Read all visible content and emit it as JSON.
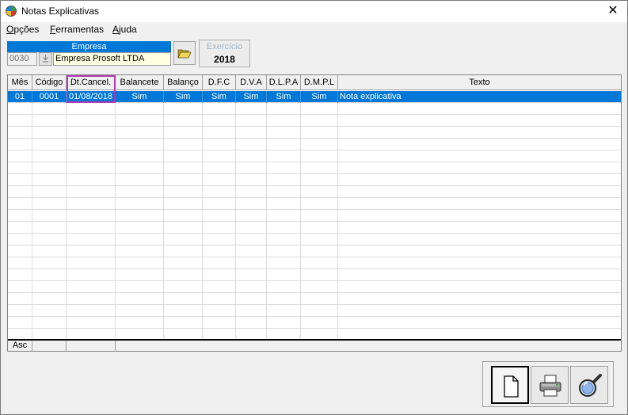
{
  "window": {
    "title": "Notas Explicativas",
    "close_glyph": "✕"
  },
  "menu": [
    {
      "underline": "O",
      "rest": "pções"
    },
    {
      "underline": "F",
      "rest": "erramentas"
    },
    {
      "underline": "A",
      "rest": "juda"
    }
  ],
  "empresa": {
    "header": "Empresa",
    "code": "0030",
    "name": "Empresa Prosoft LTDA"
  },
  "exercicio": {
    "label": "Exercício",
    "value": "2018"
  },
  "grid": {
    "columns": [
      "Mês",
      "Código",
      "Dt.Cancel.",
      "Balancete",
      "Balanço",
      "D.F.C",
      "D.V.A",
      "D.L.P.A",
      "D.M.P.L",
      "Texto"
    ],
    "rows": [
      [
        "01",
        "0001",
        "01/08/2018",
        "Sim",
        "Sim",
        "Sim",
        "Sim",
        "Sim",
        "Sim",
        "Nota explicativa"
      ]
    ],
    "footer": "Asc"
  },
  "toolbar": {
    "buttons": [
      {
        "name": "new-document-button",
        "icon": "document-icon"
      },
      {
        "name": "print-button",
        "icon": "printer-icon"
      },
      {
        "name": "search-button",
        "icon": "magnifier-icon"
      }
    ]
  },
  "colors": {
    "selection": "#0078d7",
    "highlight_box": "#b03ab5",
    "empresa_header": "#0078d7",
    "name_field": "#ffffe1"
  }
}
